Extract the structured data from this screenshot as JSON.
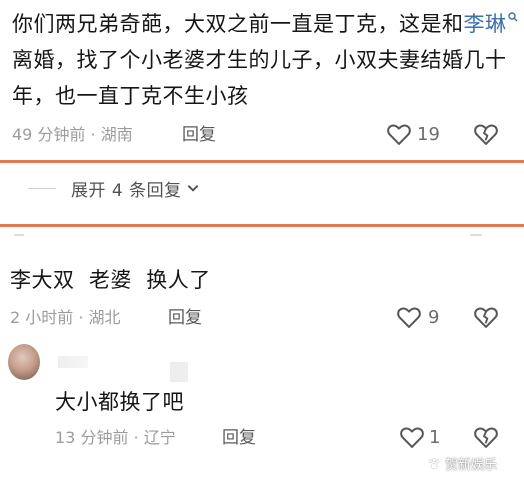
{
  "comments": [
    {
      "text_before": "你们两兄弟奇葩，大双之前一直是丁克，这是和",
      "mention": "李琳",
      "text_after": "离婚，找了个小老婆才生的儿子，小双夫妻结婚几十年，也一直丁克不生小孩",
      "time": "49 分钟前 · 湖南",
      "reply_label": "回复",
      "likes": "19"
    },
    {
      "text": "李大双  老婆  换人了",
      "time": "2 小时前 · 湖北",
      "reply_label": "回复",
      "likes": "9"
    },
    {
      "text": "大小都换了吧",
      "time": "13 分钟前 · 辽宁",
      "reply_label": "回复",
      "likes": "1"
    }
  ],
  "expand_replies": {
    "label": "展开 4 条回复",
    "icon": "chevron-down-icon"
  },
  "watermark": {
    "text": "贺新娱乐",
    "icon": "paw-icon"
  },
  "colors": {
    "divider": "#e27a50",
    "link": "#3a6fb4",
    "meta": "#9c9c9c"
  }
}
